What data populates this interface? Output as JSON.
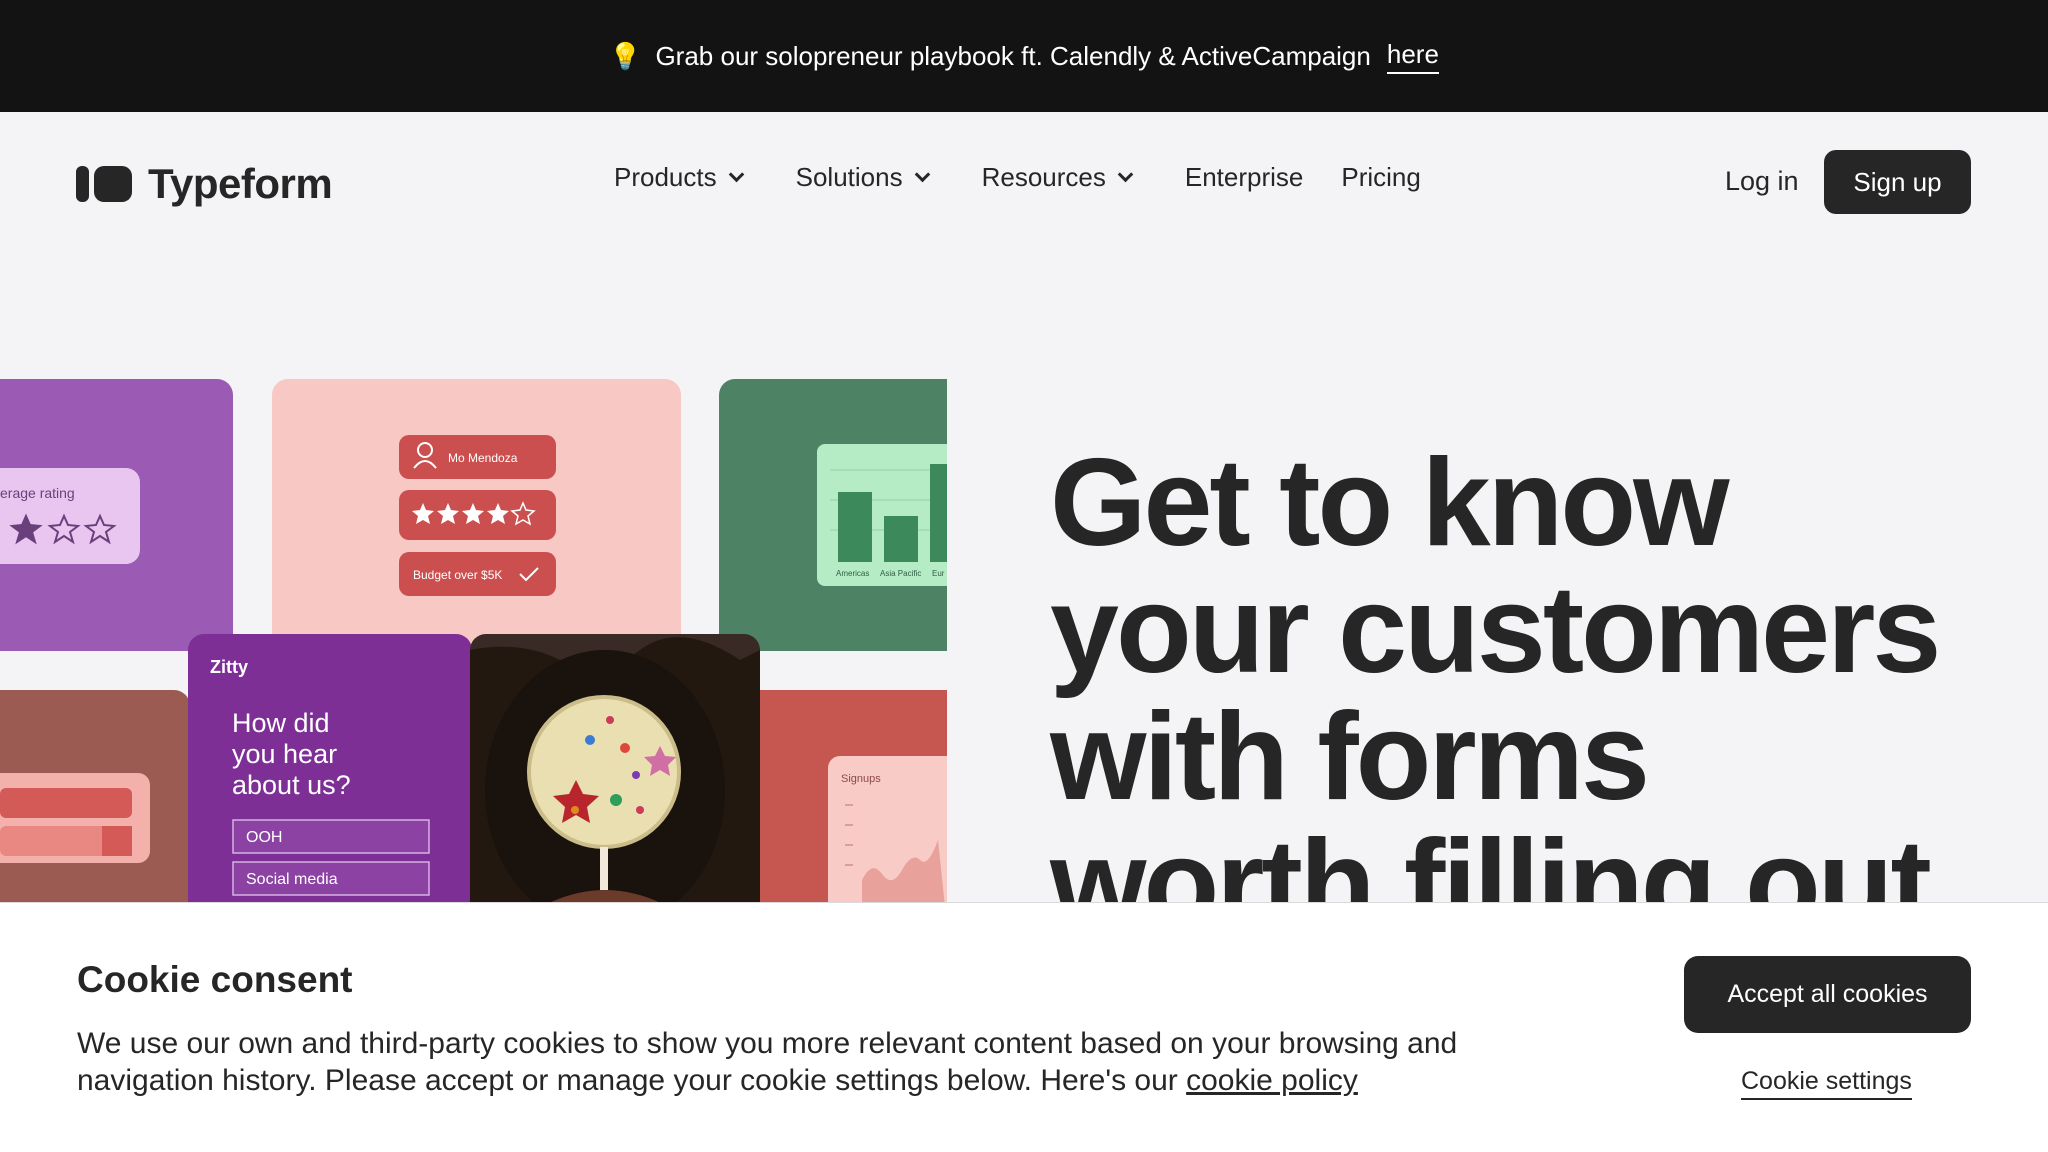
{
  "announcement": {
    "icon": "lightbulb-icon",
    "text": "Grab our solopreneur playbook ft. Calendly & ActiveCampaign",
    "link": "here"
  },
  "header": {
    "brand": "Typeform",
    "nav": [
      {
        "label": "Products",
        "has_dropdown": true
      },
      {
        "label": "Solutions",
        "has_dropdown": true
      },
      {
        "label": "Resources",
        "has_dropdown": true
      },
      {
        "label": "Enterprise",
        "has_dropdown": false
      },
      {
        "label": "Pricing",
        "has_dropdown": false
      }
    ],
    "login": "Log in",
    "signup": "Sign up"
  },
  "collage": {
    "rating_card_label": "erage rating",
    "profile_name": "Mo Mendoza",
    "budget_label": "Budget over $5K",
    "chart_labels": [
      "Americas",
      "Asia Pacific",
      "Eur"
    ],
    "form_brand": "Zitty",
    "form_question": "How did you hear about us?",
    "form_options": [
      "OOH",
      "Social media"
    ],
    "signups_label": "Signups",
    "stars_filled": 4,
    "stars_total": 5
  },
  "hero": {
    "title_lines": [
      "Get to know",
      "your customers",
      "with forms",
      "worth filling out"
    ]
  },
  "cookie": {
    "title": "Cookie consent",
    "text": "We use our own and third-party cookies to show you more relevant content based on your browsing and navigation history. Please accept or manage your cookie settings below. Here's our",
    "policy_link": "cookie policy",
    "accept": "Accept all cookies",
    "settings": "Cookie settings"
  },
  "colors": {
    "dark": "#262627",
    "announce_bg": "#131313",
    "page_bg": "#f4f4f6"
  }
}
